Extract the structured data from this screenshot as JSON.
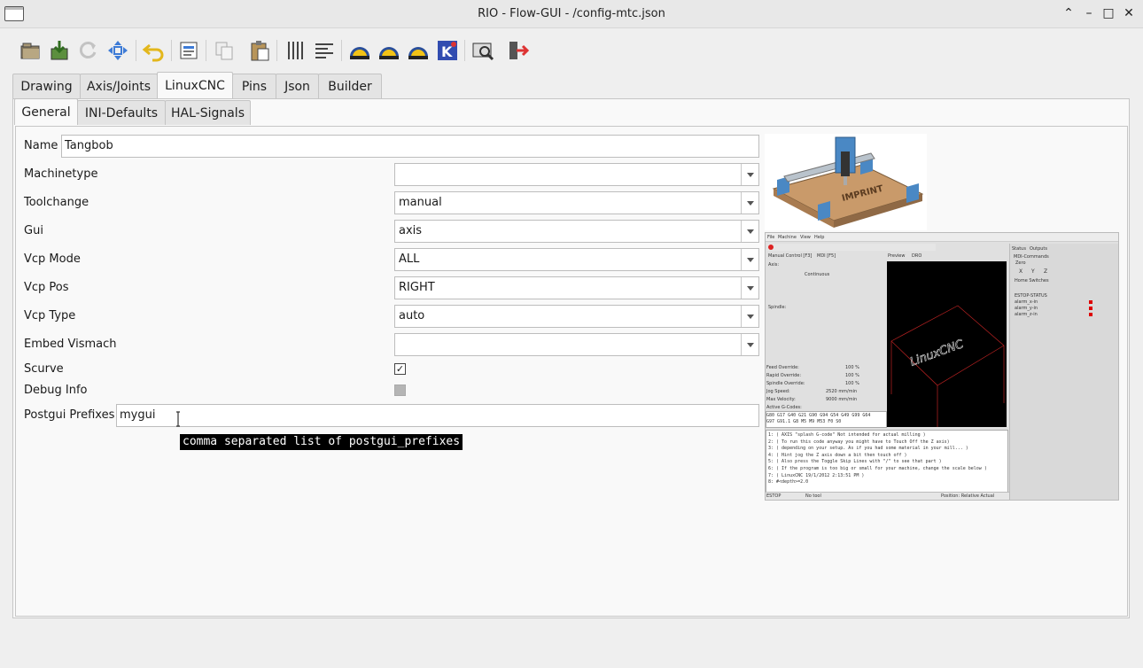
{
  "window": {
    "title": "RIO - Flow-GUI - /config-mtc.json"
  },
  "toolbar": {
    "icons": [
      "open-folder-icon",
      "save-icon",
      "reload-icon",
      "move-icon",
      "undo-icon",
      "export-icon",
      "copy-icon",
      "paste-icon",
      "columns-icon",
      "align-icon",
      "linuxcnc-icon",
      "linuxcnc-icon",
      "linuxcnc-icon",
      "kicad-icon",
      "preview-icon",
      "exit-icon"
    ]
  },
  "main_tabs": [
    "Drawing",
    "Axis/Joints",
    "LinuxCNC",
    "Pins",
    "Json",
    "Builder"
  ],
  "active_main_tab": "LinuxCNC",
  "sub_tabs": [
    "General",
    "INI-Defaults",
    "HAL-Signals"
  ],
  "active_sub_tab": "General",
  "form": {
    "name_label": "Name",
    "name_value": "Tangbob",
    "machinetype_label": "Machinetype",
    "machinetype_value": "",
    "toolchange_label": "Toolchange",
    "toolchange_value": "manual",
    "gui_label": "Gui",
    "gui_value": "axis",
    "vcp_mode_label": "Vcp Mode",
    "vcp_mode_value": "ALL",
    "vcp_pos_label": "Vcp Pos",
    "vcp_pos_value": "RIGHT",
    "vcp_type_label": "Vcp Type",
    "vcp_type_value": "auto",
    "embed_vismach_label": "Embed Vismach",
    "embed_vismach_value": "",
    "scurve_label": "Scurve",
    "scurve_checked": true,
    "debug_info_label": "Debug Info",
    "debug_info_checked": false,
    "postgui_label": "Postgui Prefixes",
    "postgui_value": "mygui"
  },
  "tooltip": "comma separated list of postgui_prefixes",
  "preview": {
    "menu": [
      "File",
      "Machine",
      "View",
      "Help"
    ],
    "tabs_left": [
      "Manual Control [F3]",
      "MDI [F5]"
    ],
    "tabs_mid": [
      "Preview",
      "DRO"
    ],
    "tabs_right": [
      "Status",
      "Outputs"
    ],
    "mode": "Continuous",
    "labels": [
      "Axis:",
      "Spindle:",
      "Feed Override:",
      "Rapid Override:",
      "Spindle Override:",
      "Jog Speed:",
      "Max Velocity:",
      "Active G-Codes:"
    ],
    "values": [
      "100 %",
      "100 %",
      "100 %",
      "2520 mm/min",
      "9000 mm/min"
    ],
    "gcodes": [
      "G80 G17 G40 G21 G90 G94 G54 G49 G99 G64",
      "G97 G91.1 G8 M5 M9 M53 F0 S0"
    ],
    "code_lines": [
      "1: ( AXIS \"splash G-code\" Not intended for actual milling )",
      "2: ( To run this code anyway you might have to Touch Off the Z axis)",
      "3: ( depending on your setup. As if you had some material in your mill... )",
      "4: ( Hint jog the Z axis down a bit then touch off )",
      "5: ( Also press the Toggle Skip Lines with \"/\" to see that part )",
      "6: ( If the program is too big or small for your machine, change the scale below )",
      "7: ( LinuxCNC 19/1/2012 2:13:51 PM )",
      "8: #<depth>=2.0"
    ],
    "status_bar": [
      "ESTOP",
      "No tool",
      "Position: Relative Actual"
    ],
    "mdi_title": "MDI-Commands",
    "zero_label": "Zero",
    "axes": [
      "X",
      "Y",
      "Z"
    ],
    "home_switches": "Home Switches",
    "estop_status": "ESTOP-STATUS",
    "alarms": [
      "alarm_x-in",
      "alarm_y-in",
      "alarm_z-in"
    ],
    "banner": "LinuxCNC"
  },
  "colors": {
    "accent": "#3d7bd6",
    "alarm": "#dd0000"
  }
}
